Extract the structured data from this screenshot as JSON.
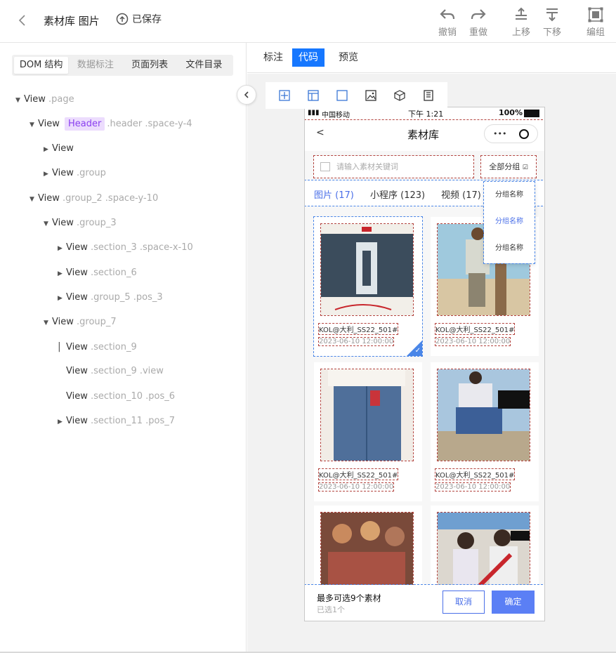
{
  "topbar": {
    "title": "素材库 图片",
    "saved_label": "已保存",
    "tools": [
      {
        "label": "撤销",
        "icon": "undo-icon"
      },
      {
        "label": "重做",
        "icon": "redo-icon"
      },
      {
        "label": "上移",
        "icon": "move-up-icon"
      },
      {
        "label": "下移",
        "icon": "move-down-icon"
      },
      {
        "label": "编组",
        "icon": "group-icon"
      }
    ]
  },
  "left_tabs": [
    "DOM 结构",
    "数据标注",
    "页面列表",
    "文件目录"
  ],
  "tree": [
    {
      "name": "View",
      "cls": ".page",
      "caret": "down",
      "badge": ""
    },
    {
      "name": "View",
      "cls": ".header .space-y-4",
      "caret": "down",
      "badge": "Header"
    },
    {
      "name": "View",
      "cls": "",
      "caret": "right",
      "badge": ""
    },
    {
      "name": "View",
      "cls": ".group",
      "caret": "right",
      "badge": ""
    },
    {
      "name": "View",
      "cls": ".group_2 .space-y-10",
      "caret": "down",
      "badge": ""
    },
    {
      "name": "View",
      "cls": ".group_3",
      "caret": "down",
      "badge": ""
    },
    {
      "name": "View",
      "cls": ".section_3 .space-x-10",
      "caret": "right",
      "badge": ""
    },
    {
      "name": "View",
      "cls": ".section_6",
      "caret": "right",
      "badge": ""
    },
    {
      "name": "View",
      "cls": ".group_5 .pos_3",
      "caret": "right",
      "badge": ""
    },
    {
      "name": "View",
      "cls": ".group_7",
      "caret": "down",
      "badge": ""
    },
    {
      "name": "View",
      "cls": ".section_9",
      "caret": "none",
      "badge": ""
    },
    {
      "name": "View",
      "cls": ".section_9 .view",
      "caret": "none",
      "badge": ""
    },
    {
      "name": "View",
      "cls": ".section_10 .pos_6",
      "caret": "none",
      "badge": ""
    },
    {
      "name": "View",
      "cls": ".section_11 .pos_7",
      "caret": "right",
      "badge": ""
    }
  ],
  "right_tabs": [
    "标注",
    "代码",
    "预览"
  ],
  "phone": {
    "carrier": "中国移动",
    "time": "下午 1:21",
    "battery": "100%",
    "nav_title": "素材库",
    "search_placeholder": "请输入素材关键词",
    "all_groups": "全部分组",
    "tabs": [
      "图片 (17)",
      "小程序 (123)",
      "视频 (17)"
    ],
    "dropdown": [
      "分组名称",
      "分组名称",
      "分组名称"
    ],
    "cards": [
      {
        "caption": "KOL@大利_SS22_501#",
        "date": "2023-06-10 12:00:00"
      },
      {
        "caption": "KOL@大利_SS22_501#",
        "date": "2023-06-10 12:00:00"
      },
      {
        "caption": "KOL@大利_SS22_501#",
        "date": "2023-06-10 12:00:00"
      },
      {
        "caption": "KOL@大利_SS22_501#",
        "date": "2023-06-10 12:00:00"
      }
    ],
    "footer_max": "最多可选9个素材",
    "footer_selected": "已选1个",
    "cancel": "取消",
    "confirm": "确定"
  },
  "colors": {
    "accent": "#1677ff",
    "badge_bg": "#ecdcfd",
    "badge_fg": "#8a3ff0",
    "confirm": "#5b7ff5"
  }
}
